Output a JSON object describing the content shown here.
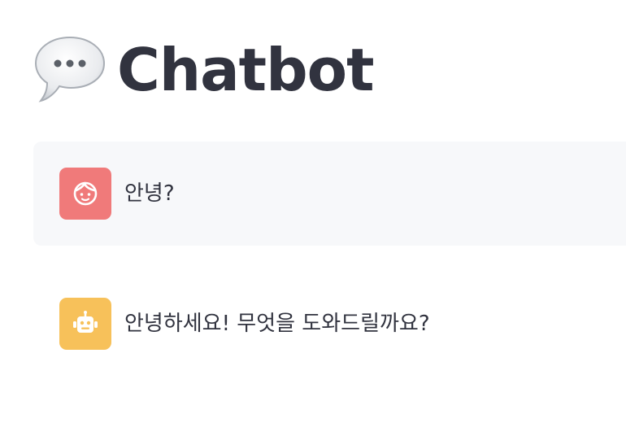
{
  "header": {
    "title": "Chatbot",
    "icon": "speech-balloon-icon"
  },
  "messages": [
    {
      "role": "user",
      "avatar_icon": "user-face-icon",
      "avatar_color": "#f07a7a",
      "text": "안녕?"
    },
    {
      "role": "assistant",
      "avatar_icon": "robot-icon",
      "avatar_color": "#f7c15a",
      "text": "안녕하세요! 무엇을 도와드릴까요?"
    }
  ],
  "colors": {
    "user_message_bg": "#f7f8fa",
    "text": "#31333f"
  }
}
